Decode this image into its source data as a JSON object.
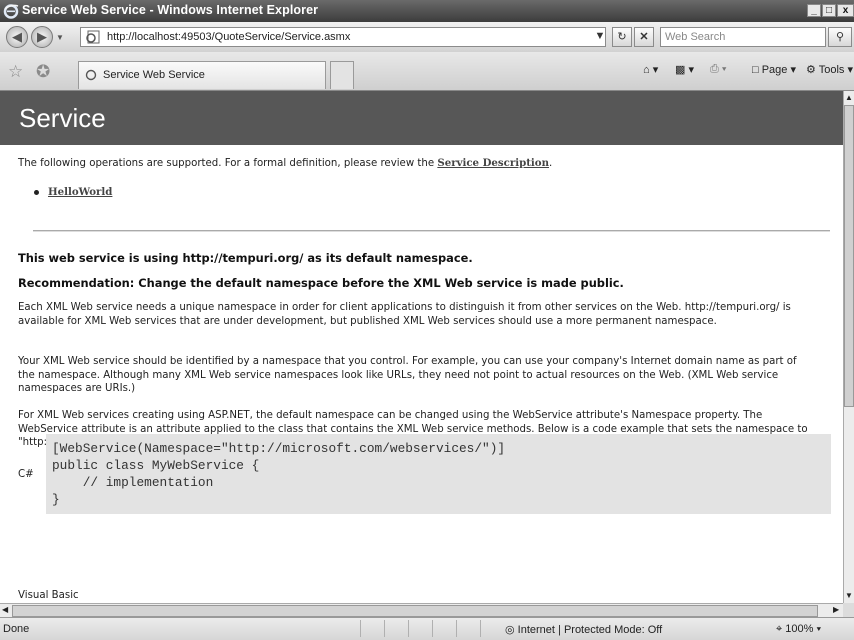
{
  "window": {
    "title": "Service Web Service - Windows Internet Explorer",
    "minimize": "_",
    "maximize": "□",
    "close": "x"
  },
  "address": {
    "url": "http://localhost:49503/QuoteService/Service.asmx",
    "search_placeholder": "Web Search"
  },
  "tabs": [
    {
      "label": "Service Web Service"
    }
  ],
  "command_bar": {
    "page": "Page",
    "tools": "Tools"
  },
  "page": {
    "heading": "Service",
    "intro_before": "The following operations are supported. For a formal definition, please review the ",
    "intro_link": "Service Description",
    "intro_after": ".",
    "operations": [
      "HelloWorld"
    ],
    "namespace_notice": "This web service is using http://tempuri.org/ as its default namespace.",
    "recommendation": "Recommendation: Change the default namespace before the XML Web service is made public.",
    "para1": "Each XML Web service needs a unique namespace in order for client applications to distinguish it from other services on the Web. http://tempuri.org/ is available for XML Web services that are under development, but published XML Web services should use a more permanent namespace.",
    "para2": "Your XML Web service should be identified by a namespace that you control. For example, you can use your company's Internet domain name as part of the namespace. Although many XML Web service namespaces look like URLs, they need not point to actual resources on the Web. (XML Web service namespaces are URIs.)",
    "para3": "For XML Web services creating using ASP.NET, the default namespace can be changed using the WebService attribute's Namespace property. The WebService attribute is an attribute applied to the class that contains the XML Web service methods. Below is a code example that sets the namespace to \"http://microsoft.com/webservices/\":",
    "csharp_label": "C#",
    "code_csharp": "[WebService(Namespace=\"http://microsoft.com/webservices/\")]\npublic class MyWebService {\n    // implementation\n}",
    "vb_label": "Visual Basic"
  },
  "status": {
    "text": "Done",
    "zone": "Internet | Protected Mode: Off",
    "zoom": "100%"
  }
}
